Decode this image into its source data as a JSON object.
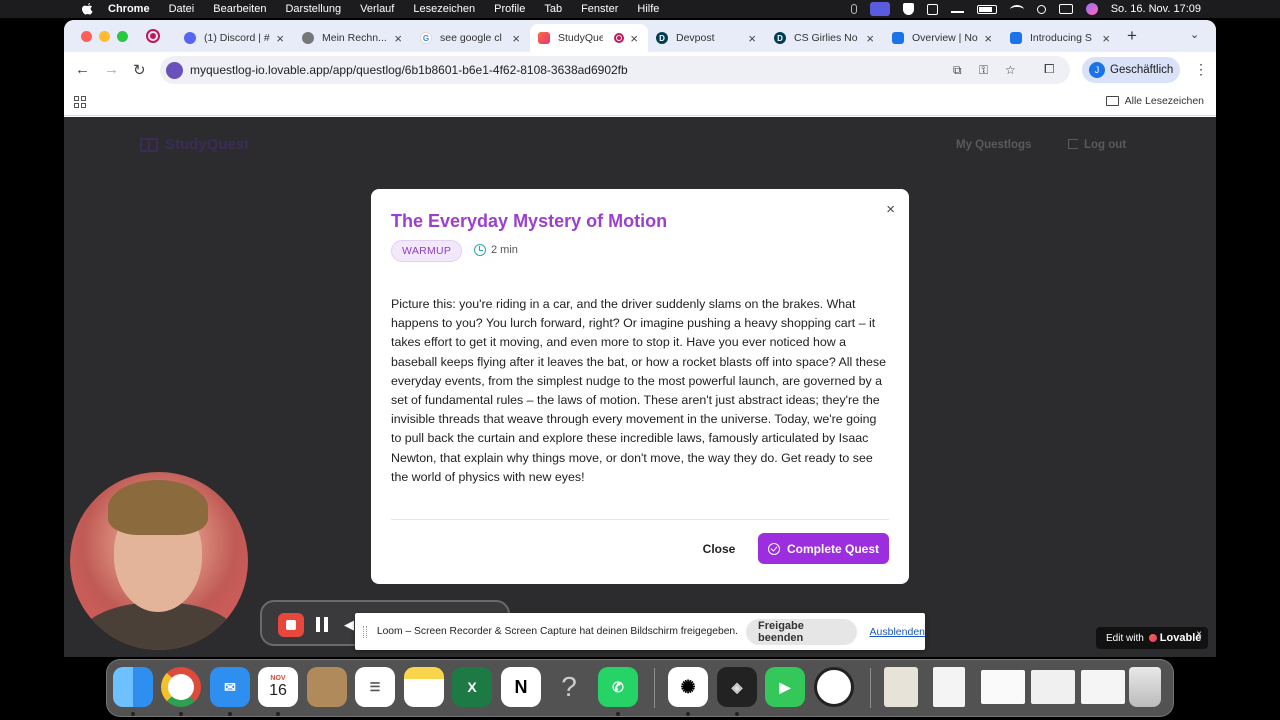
{
  "menubar": {
    "app": "Chrome",
    "items": [
      "Datei",
      "Bearbeiten",
      "Darstellung",
      "Verlauf",
      "Lesezeichen",
      "Profile",
      "Tab",
      "Fenster",
      "Hilfe"
    ],
    "datetime": "So. 16. Nov.  17:09"
  },
  "tabs": [
    {
      "title": "(1) Discord | #",
      "color": "#5865f2",
      "glyph": ""
    },
    {
      "title": "Mein Rechn...",
      "color": "#777777",
      "glyph": ""
    },
    {
      "title": "see google cl",
      "color": "#4285f4",
      "glyph": "G"
    },
    {
      "title": "StudyQue",
      "color": "#e0387a",
      "glyph": ""
    },
    {
      "title": "Devpost",
      "color": "#003e54",
      "glyph": "D"
    },
    {
      "title": "CS Girlies No",
      "color": "#003e54",
      "glyph": "D"
    },
    {
      "title": "Overview | No",
      "color": "#1a73e8",
      "glyph": ""
    },
    {
      "title": "Introducing S",
      "color": "#1a73e8",
      "glyph": ""
    }
  ],
  "browser": {
    "url": "myquestlog-io.lovable.app/app/questlog/6b1b8601-b6e1-4f62-8108-3638ad6902fb",
    "profile_initial": "J",
    "profile_label": "Geschäftlich",
    "bookmarks_label": "Alle Lesezeichen"
  },
  "app": {
    "logo": "StudyQuest",
    "nav_questlogs": "My Questlogs",
    "nav_logout": "Log out"
  },
  "modal": {
    "title": "The Everyday Mystery of Motion",
    "badge": "WARMUP",
    "duration": "2 min",
    "body": "Picture this: you're riding in a car, and the driver suddenly slams on the brakes. What happens to you? You lurch forward, right? Or imagine pushing a heavy shopping cart – it takes effort to get it moving, and even more to stop it. Have you ever noticed how a baseball keeps flying after it leaves the bat, or how a rocket blasts off into space? All these everyday events, from the simplest nudge to the most powerful launch, are governed by a set of fundamental rules – the laws of motion. These aren't just abstract ideas; they're the invisible threads that weave through every movement in the universe. Today, we're going to pull back the curtain and explore these incredible laws, famously articulated by Isaac Newton, that explain why things move, or don't move, the way they do. Get ready to see the world of physics with new eyes!",
    "close_label": "Close",
    "complete_label": "Complete Quest"
  },
  "share_bar": {
    "text": "Loom – Screen Recorder & Screen Capture hat deinen Bildschirm freigegeben.",
    "stop_label": "Freigabe beenden",
    "hide_label": "Ausblenden"
  },
  "lovable_badge": {
    "prefix": "Edit with",
    "brand": "Lovable"
  },
  "dock": {
    "calendar_month": "NOV",
    "calendar_day": "16",
    "items": [
      "finder",
      "chrome",
      "mail",
      "calendar",
      "contacts",
      "reminders",
      "notes",
      "excel",
      "notion",
      "help",
      "whatsapp",
      "chatgpt",
      "app",
      "facetime",
      "clock",
      "preview",
      "document",
      "window1",
      "window2",
      "window3",
      "trash"
    ]
  }
}
